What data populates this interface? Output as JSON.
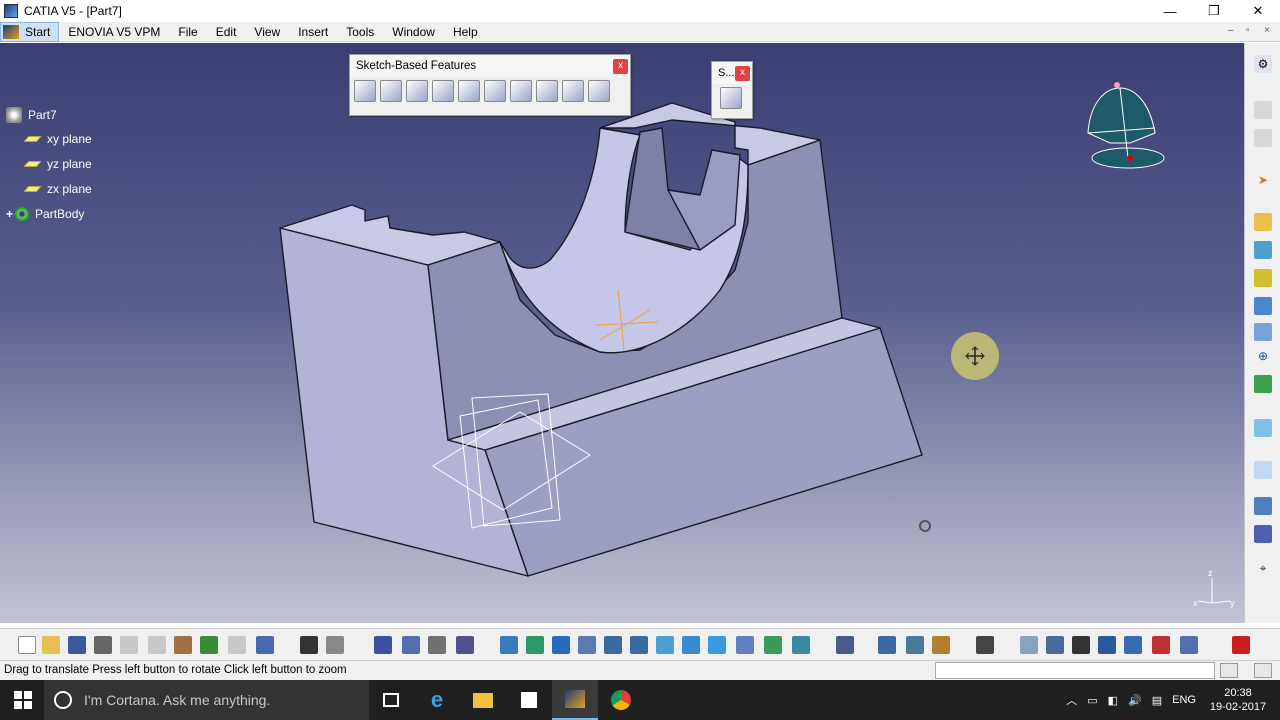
{
  "window": {
    "title": "CATIA V5 - [Part7]",
    "minimize": "—",
    "restore": "❐",
    "close": "✕"
  },
  "menu": {
    "start": "Start",
    "items": [
      "ENOVIA V5 VPM",
      "File",
      "Edit",
      "View",
      "Insert",
      "Tools",
      "Window",
      "Help"
    ],
    "mdi_min": "–",
    "mdi_restore": "▫",
    "mdi_close": "×"
  },
  "tree": {
    "root": "Part7",
    "children": [
      "xy plane",
      "yz plane",
      "zx plane"
    ],
    "body": "PartBody"
  },
  "toolbars": {
    "sketch_based": {
      "title": "Sketch-Based Features",
      "close": "x"
    },
    "sketcher": {
      "title": "S...",
      "close": "x"
    }
  },
  "status": {
    "message": "Drag to translate  Press left button to rotate  Click left button to zoom"
  },
  "taskbar": {
    "search_placeholder": "I'm Cortana. Ask me anything.",
    "language": "ENG",
    "time": "20:38",
    "date": "19-02-2017"
  },
  "compass": {
    "axis_x": "x",
    "axis_y": "y",
    "axis_z": "z"
  },
  "colors": {
    "viewport_top": "#3a3e72",
    "viewport_bottom": "#c2c3d4",
    "part_face": "#b9badc",
    "part_face_dark": "#8f90b6",
    "accent": "#f0a030"
  },
  "icons": {
    "start_logo": "catia-logo-icon",
    "compass": "compass-icon",
    "pan_cursor": "pan-cursor-icon"
  }
}
